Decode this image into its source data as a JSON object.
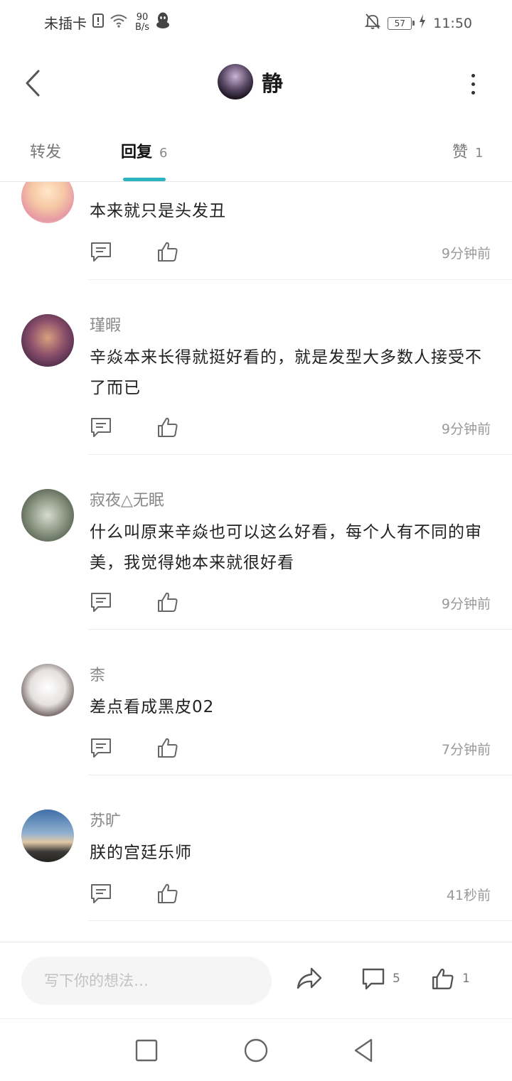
{
  "status_bar": {
    "sim": "未插卡",
    "net_speed_value": "90",
    "net_speed_unit": "B/s",
    "battery": "57",
    "time": "11:50"
  },
  "header": {
    "name": "静"
  },
  "tabs": [
    {
      "label": "转发",
      "count": ""
    },
    {
      "label": "回复",
      "count": "6"
    },
    {
      "label": "赞",
      "count": "1"
    }
  ],
  "comments": [
    {
      "user": "",
      "text": "本来就只是头发丑",
      "time": "9分钟前"
    },
    {
      "user": "瑾暇",
      "text": "辛焱本来长得就挺好看的，就是发型大多数人接受不了而已",
      "time": "9分钟前"
    },
    {
      "user": "寂夜△无眠",
      "text": "什么叫原来辛焱也可以这么好看，每个人有不同的审美，我觉得她本来就很好看",
      "time": "9分钟前"
    },
    {
      "user": "柰",
      "text": "差点看成黑皮02",
      "time": "7分钟前"
    },
    {
      "user": "苏旷",
      "text": "朕的宫廷乐师",
      "time": "41秒前"
    }
  ],
  "bottom_bar": {
    "input_placeholder": "写下你的想法…",
    "comment_count": "5",
    "like_count": "1"
  },
  "colors": {
    "accent": "#2bb3bf"
  }
}
